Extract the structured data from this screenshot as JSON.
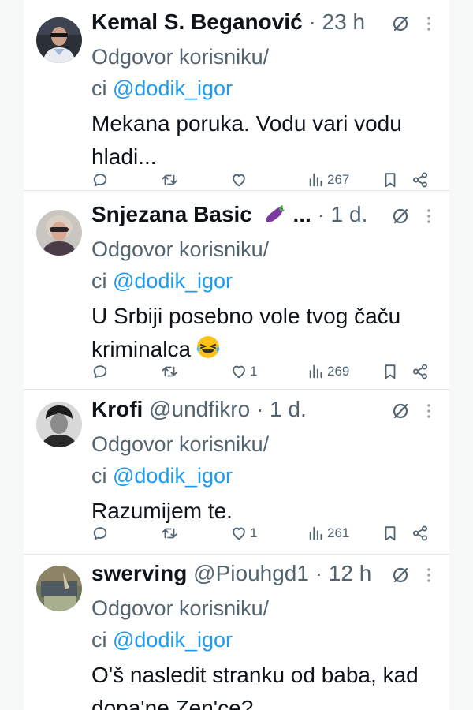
{
  "colors": {
    "text": "#0f1419",
    "secondary": "#536471",
    "link": "#1d9bf0",
    "divider": "#e3e6e8"
  },
  "tweets": [
    {
      "name": "Kemal S. Beganović",
      "handle": "",
      "separator": "·",
      "time": "23 h",
      "reply_prefix_line1": "Odgovor korisniku/",
      "reply_prefix_line2": "ci ",
      "mention": "@dodik_igor",
      "text_lines": [
        "Mekana poruka. Vodu vari vodu",
        "hladi..."
      ],
      "replies": "",
      "retweets": "",
      "likes": "",
      "views": "267",
      "icons": [
        "reply-icon",
        "retweet-icon",
        "heart-icon",
        "views-icon",
        "bookmark-icon",
        "share-icon"
      ]
    },
    {
      "name": "Snjezana Basic",
      "name_emoji": "eggplant-emoji",
      "name_suffix": "...",
      "handle": "",
      "separator": "·",
      "time": "1 d.",
      "reply_prefix_line1": "Odgovor korisniku/",
      "reply_prefix_line2": "ci ",
      "mention": "@dodik_igor",
      "text_lines": [
        "U Srbiji posebno vole tvog čaču",
        "kriminalca"
      ],
      "text_emoji": "laughing-tears-emoji",
      "replies": "",
      "retweets": "",
      "likes": "1",
      "views": "269"
    },
    {
      "name": "Krofi",
      "handle": "@undfikro",
      "separator": "·",
      "time": "1 d.",
      "reply_prefix_line1": "Odgovor korisniku/",
      "reply_prefix_line2": "ci ",
      "mention": "@dodik_igor",
      "text_lines": [
        "Razumijem te."
      ],
      "replies": "",
      "retweets": "",
      "likes": "1",
      "views": "261"
    },
    {
      "name": "swerving",
      "handle": "@Piouhgd1",
      "separator": "·",
      "time": "12 h",
      "reply_prefix_line1": "Odgovor korisniku/",
      "reply_prefix_line2": "ci ",
      "mention": "@dodik_igor",
      "text_lines": [
        "O'š nasledit stranku od baba, kad",
        "dopa'ne Zen'ce?"
      ]
    }
  ]
}
